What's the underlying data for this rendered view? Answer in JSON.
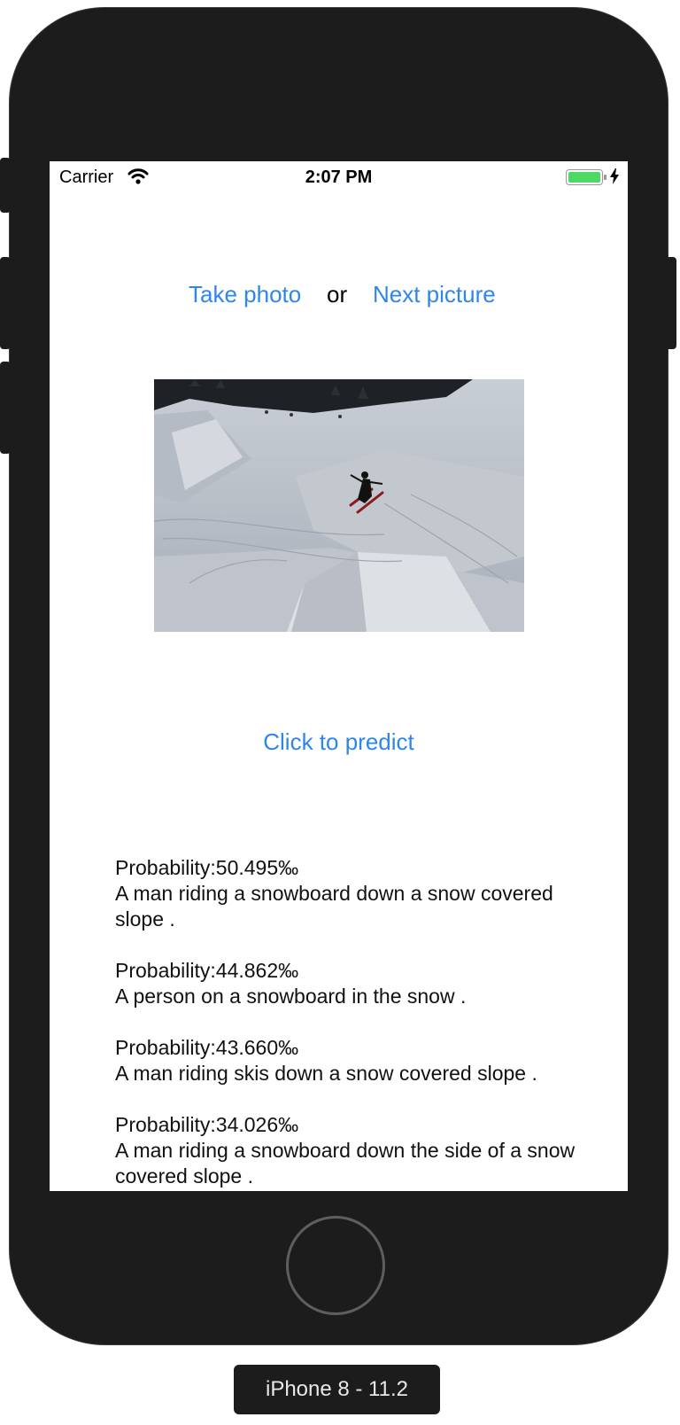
{
  "status_bar": {
    "carrier": "Carrier",
    "time": "2:07 PM",
    "battery_color": "#4cd964"
  },
  "actions": {
    "take_photo": "Take photo",
    "or": "or",
    "next_picture": "Next picture",
    "predict": "Click to predict"
  },
  "results": [
    {
      "probability": "Probability:50.495‰",
      "caption": " A man riding a snowboard down a snow covered slope ."
    },
    {
      "probability": "Probability:44.862‰",
      "caption": " A person on a snowboard in the snow ."
    },
    {
      "probability": "Probability:43.660‰",
      "caption": " A man riding skis down a snow covered slope ."
    },
    {
      "probability": "Probability:34.026‰",
      "caption": " A man riding a snowboard down the side of a snow covered slope ."
    }
  ],
  "device_label": "iPhone 8 - 11.2",
  "colors": {
    "accent": "#2f86ea",
    "device": "#1c1c1d"
  }
}
